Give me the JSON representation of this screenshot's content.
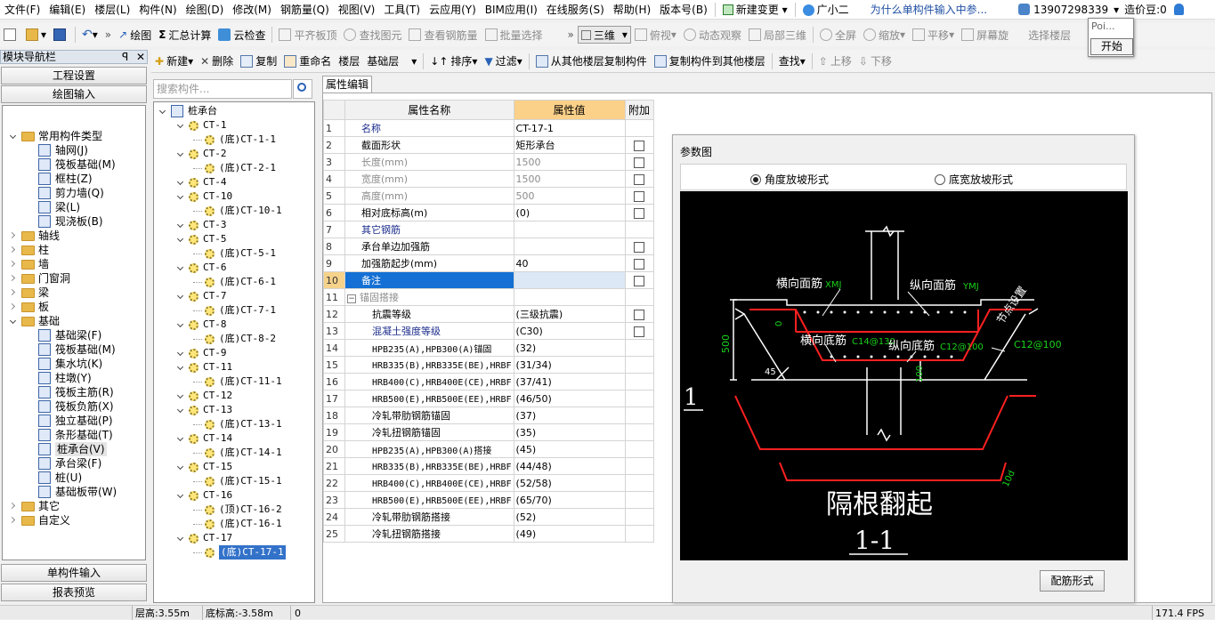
{
  "menubar": {
    "items": [
      "文件(F)",
      "编辑(E)",
      "楼层(L)",
      "构件(N)",
      "绘图(D)",
      "修改(M)",
      "钢筋量(Q)",
      "视图(V)",
      "工具(T)",
      "云应用(Y)",
      "BIM应用(I)",
      "在线服务(S)",
      "帮助(H)",
      "版本号(B)"
    ],
    "new_change": "新建变更",
    "assistant": "广小二",
    "ad": "为什么单构件输入中参...",
    "phone": "13907298339",
    "beans": "造价豆:0"
  },
  "popup": {
    "title": "Poi...",
    "start": "开始"
  },
  "toolbar1": {
    "draw": "绘图",
    "sum": "汇总计算",
    "cloud_check": "云检查",
    "align_slab": "平齐板顶",
    "find_elem": "查找图元",
    "view_rebar": "查看钢筋量",
    "batch_select": "批量选择",
    "view3d": "三维",
    "top_view": "俯视",
    "dynamic": "动态观察",
    "partial3d": "局部三维",
    "fullscreen": "全屏",
    "zoom": "缩放",
    "pan": "平移",
    "rotate": "屏幕旋",
    "select_floor": "选择楼层"
  },
  "toolbar2": {
    "new": "新建",
    "delete": "删除",
    "copy": "复制",
    "rename": "重命名",
    "floor_label": "楼层",
    "floor_value": "基础层",
    "sort": "排序",
    "filter": "过滤",
    "copy_from": "从其他楼层复制构件",
    "copy_to": "复制构件到其他楼层",
    "find": "查找",
    "up": "上移",
    "down": "下移"
  },
  "nav": {
    "title": "模块导航栏",
    "pin": "ꟼ",
    "close": "✕",
    "project_settings": "工程设置",
    "draw_input": "绘图输入",
    "single_input": "单构件输入",
    "report_preview": "报表预览",
    "tree": [
      {
        "label": "常用构件类型",
        "level": 0,
        "type": "folder",
        "toggle": "open"
      },
      {
        "label": "轴网(J)",
        "level": 1,
        "type": "comp"
      },
      {
        "label": "筏板基础(M)",
        "level": 1,
        "type": "comp"
      },
      {
        "label": "框柱(Z)",
        "level": 1,
        "type": "comp"
      },
      {
        "label": "剪力墙(Q)",
        "level": 1,
        "type": "comp"
      },
      {
        "label": "梁(L)",
        "level": 1,
        "type": "comp"
      },
      {
        "label": "现浇板(B)",
        "level": 1,
        "type": "comp"
      },
      {
        "label": "轴线",
        "level": 0,
        "type": "folder",
        "toggle": "closed"
      },
      {
        "label": "柱",
        "level": 0,
        "type": "folder",
        "toggle": "closed"
      },
      {
        "label": "墙",
        "level": 0,
        "type": "folder",
        "toggle": "closed"
      },
      {
        "label": "门窗洞",
        "level": 0,
        "type": "folder",
        "toggle": "closed"
      },
      {
        "label": "梁",
        "level": 0,
        "type": "folder",
        "toggle": "closed"
      },
      {
        "label": "板",
        "level": 0,
        "type": "folder",
        "toggle": "closed"
      },
      {
        "label": "基础",
        "level": 0,
        "type": "folder",
        "toggle": "open"
      },
      {
        "label": "基础梁(F)",
        "level": 1,
        "type": "comp"
      },
      {
        "label": "筏板基础(M)",
        "level": 1,
        "type": "comp"
      },
      {
        "label": "集水坑(K)",
        "level": 1,
        "type": "comp"
      },
      {
        "label": "柱墩(Y)",
        "level": 1,
        "type": "comp"
      },
      {
        "label": "筏板主筋(R)",
        "level": 1,
        "type": "comp"
      },
      {
        "label": "筏板负筋(X)",
        "level": 1,
        "type": "comp"
      },
      {
        "label": "独立基础(P)",
        "level": 1,
        "type": "comp"
      },
      {
        "label": "条形基础(T)",
        "level": 1,
        "type": "comp"
      },
      {
        "label": "桩承台(V)",
        "level": 1,
        "type": "comp",
        "selected": true
      },
      {
        "label": "承台梁(F)",
        "level": 1,
        "type": "comp"
      },
      {
        "label": "桩(U)",
        "level": 1,
        "type": "comp"
      },
      {
        "label": "基础板带(W)",
        "level": 1,
        "type": "comp"
      },
      {
        "label": "其它",
        "level": 0,
        "type": "folder",
        "toggle": "closed"
      },
      {
        "label": "自定义",
        "level": 0,
        "type": "folder",
        "toggle": "closed"
      }
    ]
  },
  "comp_search": {
    "placeholder": "搜索构件..."
  },
  "comp_tree": [
    {
      "label": "桩承台",
      "level": 0,
      "kind": "root"
    },
    {
      "label": "CT-1",
      "level": 1,
      "kind": "gear"
    },
    {
      "label": "(底)CT-1-1",
      "level": 2,
      "kind": "gear"
    },
    {
      "label": "CT-2",
      "level": 1,
      "kind": "gear"
    },
    {
      "label": "(底)CT-2-1",
      "level": 2,
      "kind": "gear"
    },
    {
      "label": "CT-4",
      "level": 1,
      "kind": "gear"
    },
    {
      "label": "CT-10",
      "level": 1,
      "kind": "gear"
    },
    {
      "label": "(底)CT-10-1",
      "level": 2,
      "kind": "gear"
    },
    {
      "label": "CT-3",
      "level": 1,
      "kind": "gear"
    },
    {
      "label": "CT-5",
      "level": 1,
      "kind": "gear"
    },
    {
      "label": "(底)CT-5-1",
      "level": 2,
      "kind": "gear"
    },
    {
      "label": "CT-6",
      "level": 1,
      "kind": "gear"
    },
    {
      "label": "(底)CT-6-1",
      "level": 2,
      "kind": "gear"
    },
    {
      "label": "CT-7",
      "level": 1,
      "kind": "gear"
    },
    {
      "label": "(底)CT-7-1",
      "level": 2,
      "kind": "gear"
    },
    {
      "label": "CT-8",
      "level": 1,
      "kind": "gear"
    },
    {
      "label": "(底)CT-8-2",
      "level": 2,
      "kind": "gear"
    },
    {
      "label": "CT-9",
      "level": 1,
      "kind": "gear"
    },
    {
      "label": "CT-11",
      "level": 1,
      "kind": "gear"
    },
    {
      "label": "(底)CT-11-1",
      "level": 2,
      "kind": "gear"
    },
    {
      "label": "CT-12",
      "level": 1,
      "kind": "gear"
    },
    {
      "label": "CT-13",
      "level": 1,
      "kind": "gear"
    },
    {
      "label": "(底)CT-13-1",
      "level": 2,
      "kind": "gear"
    },
    {
      "label": "CT-14",
      "level": 1,
      "kind": "gear"
    },
    {
      "label": "(底)CT-14-1",
      "level": 2,
      "kind": "gear"
    },
    {
      "label": "CT-15",
      "level": 1,
      "kind": "gear"
    },
    {
      "label": "(底)CT-15-1",
      "level": 2,
      "kind": "gear"
    },
    {
      "label": "CT-16",
      "level": 1,
      "kind": "gear"
    },
    {
      "label": "(顶)CT-16-2",
      "level": 2,
      "kind": "gear"
    },
    {
      "label": "(底)CT-16-1",
      "level": 2,
      "kind": "gear"
    },
    {
      "label": "CT-17",
      "level": 1,
      "kind": "gear"
    },
    {
      "label": "(底)CT-17-1",
      "level": 2,
      "kind": "gear",
      "selected": true
    }
  ],
  "prop": {
    "tab": "属性编辑",
    "header_name": "属性名称",
    "header_value": "属性值",
    "header_extra": "附加",
    "rows": [
      {
        "n": "1",
        "name": "名称",
        "value": "CT-17-1",
        "style": "blue",
        "check": false
      },
      {
        "n": "2",
        "name": "截面形状",
        "value": "矩形承台",
        "style": "normal",
        "check": true
      },
      {
        "n": "3",
        "name": "长度(mm)",
        "value": "1500",
        "style": "gray",
        "check": true
      },
      {
        "n": "4",
        "name": "宽度(mm)",
        "value": "1500",
        "style": "gray",
        "check": true
      },
      {
        "n": "5",
        "name": "高度(mm)",
        "value": "500",
        "style": "gray",
        "check": true
      },
      {
        "n": "6",
        "name": "相对底标高(m)",
        "value": "(0)",
        "style": "normal",
        "check": true
      },
      {
        "n": "7",
        "name": "其它钢筋",
        "value": "",
        "style": "blue",
        "check": false
      },
      {
        "n": "8",
        "name": "承台单边加强筋",
        "value": "",
        "style": "normal",
        "check": true
      },
      {
        "n": "9",
        "name": "加强筋起步(mm)",
        "value": "40",
        "style": "normal",
        "check": true
      },
      {
        "n": "10",
        "name": "备注",
        "value": "",
        "style": "selected",
        "check": true
      },
      {
        "n": "11",
        "name": "锚固搭接",
        "value": "",
        "style": "group",
        "check": false
      },
      {
        "n": "12",
        "name": "抗震等级",
        "value": "(三级抗震)",
        "style": "indent",
        "check": true
      },
      {
        "n": "13",
        "name": "混凝土强度等级",
        "value": "(C30)",
        "style": "indentblue",
        "check": true
      },
      {
        "n": "14",
        "name": "HPB235(A),HPB300(A)锚固",
        "value": "(32)",
        "style": "indentmono",
        "check": false
      },
      {
        "n": "15",
        "name": "HRB335(B),HRB335E(BE),HRBF",
        "value": "(31/34)",
        "style": "indentmono",
        "check": false
      },
      {
        "n": "16",
        "name": "HRB400(C),HRB400E(CE),HRBF",
        "value": "(37/41)",
        "style": "indentmono",
        "check": false
      },
      {
        "n": "17",
        "name": "HRB500(E),HRB500E(EE),HRBF",
        "value": "(46/50)",
        "style": "indentmono",
        "check": false
      },
      {
        "n": "18",
        "name": "冷轧带肋钢筋锚固",
        "value": "(37)",
        "style": "indent",
        "check": false
      },
      {
        "n": "19",
        "name": "冷轧扭钢筋锚固",
        "value": "(35)",
        "style": "indent",
        "check": false
      },
      {
        "n": "20",
        "name": "HPB235(A),HPB300(A)搭接",
        "value": "(45)",
        "style": "indentmono",
        "check": false
      },
      {
        "n": "21",
        "name": "HRB335(B),HRB335E(BE),HRBF",
        "value": "(44/48)",
        "style": "indentmono",
        "check": false
      },
      {
        "n": "22",
        "name": "HRB400(C),HRB400E(CE),HRBF",
        "value": "(52/58)",
        "style": "indentmono",
        "check": false
      },
      {
        "n": "23",
        "name": "HRB500(E),HRB500E(EE),HRBF",
        "value": "(65/70)",
        "style": "indentmono",
        "check": false
      },
      {
        "n": "24",
        "name": "冷轧带肋钢筋搭接",
        "value": "(52)",
        "style": "indent",
        "check": false
      },
      {
        "n": "25",
        "name": "冷轧扭钢筋搭接",
        "value": "(49)",
        "style": "indent",
        "check": false
      }
    ]
  },
  "param": {
    "title": "参数图",
    "radio1": "角度放坡形式",
    "radio2": "底宽放坡形式",
    "button": "配筋形式",
    "drawing": {
      "top_h": "横向面筋",
      "top_h_code": "XMJ",
      "top_v": "纵向面筋",
      "top_v_code": "YMJ",
      "bot_h": "横向底筋",
      "bot_h_spec": "C14@130",
      "bot_v": "纵向底筋",
      "bot_v_spec": "C12@100",
      "side_note": "节点设置",
      "side_spec": "C12@100",
      "height": "500",
      "angle": "45",
      "dim100": "100",
      "dim0": "0",
      "section_no": "1",
      "hint": "隔根翻起",
      "section": "1-1",
      "len_10d": "10d"
    }
  },
  "status": {
    "floor_height": "层高:3.55m",
    "bottom_elev": "底标高:-3.58m",
    "count": "0",
    "fps": "171.4 FPS"
  },
  "colors": {
    "accent": "#3372c9",
    "header_value": "#fbd089",
    "selected_row": "#1470d4",
    "drawing_bg": "#000000",
    "rebar_red": "#ff2020",
    "rebar_green": "#19d419"
  }
}
